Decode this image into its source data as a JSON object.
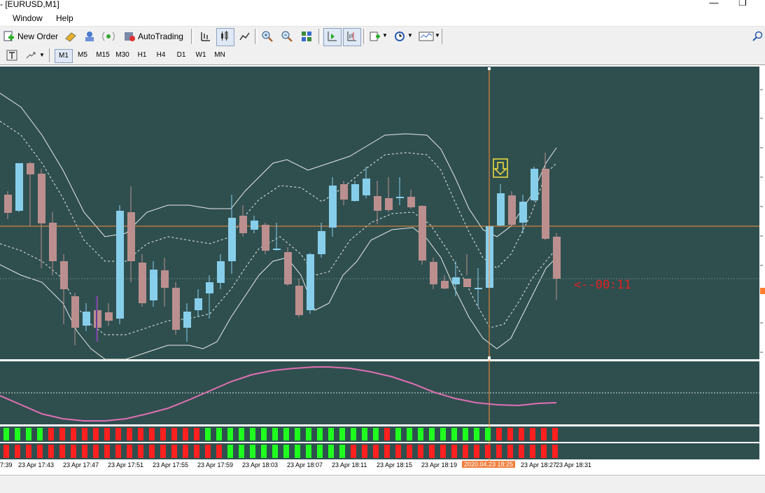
{
  "window": {
    "title": "- [EURUSD,M1]",
    "minimize": "—",
    "restore": "❐"
  },
  "menu": {
    "items": [
      "Window",
      "Help"
    ]
  },
  "toolbar": {
    "new_order_label": "New Order",
    "autotrading_label": "AutoTrading",
    "icons": [
      "new-order-icon",
      "history-icon",
      "terminal-icon",
      "signal-icon",
      "autotrading-icon",
      "bar-chart-icon",
      "candles-icon",
      "line-chart-icon",
      "zoom-in-icon",
      "zoom-out-icon",
      "tile-icon",
      "autoscroll-icon",
      "chart-shift-icon",
      "indicators-icon",
      "periods-icon",
      "templates-icon",
      "search-icon"
    ]
  },
  "timeframes": {
    "items": [
      "M1",
      "M5",
      "M15",
      "M30",
      "H1",
      "H4",
      "D1",
      "W1",
      "MN"
    ],
    "active": "M1"
  },
  "chart": {
    "symbol": "EURUSD",
    "period": "M1",
    "background": "#2f4f4f",
    "bull_color": "#87ceeb",
    "bear_color": "#bc8f8f",
    "crosshair_time": "2020.04.23 18:25",
    "timer_text": "<--00:11",
    "time_labels": [
      "7:39",
      "23 Apr 17:43",
      "23 Apr 17:47",
      "23 Apr 17:51",
      "23 Apr 17:55",
      "23 Apr 17:59",
      "23 Apr 18:03",
      "23 Apr 18:07",
      "23 Apr 18:11",
      "23 Apr 18:15",
      "23 Apr 18:19",
      "2020.04.23 18:25",
      "23 Apr 18:27",
      "23 Apr 18:31"
    ],
    "arrow_signal": "down-arrow-icon"
  }
}
